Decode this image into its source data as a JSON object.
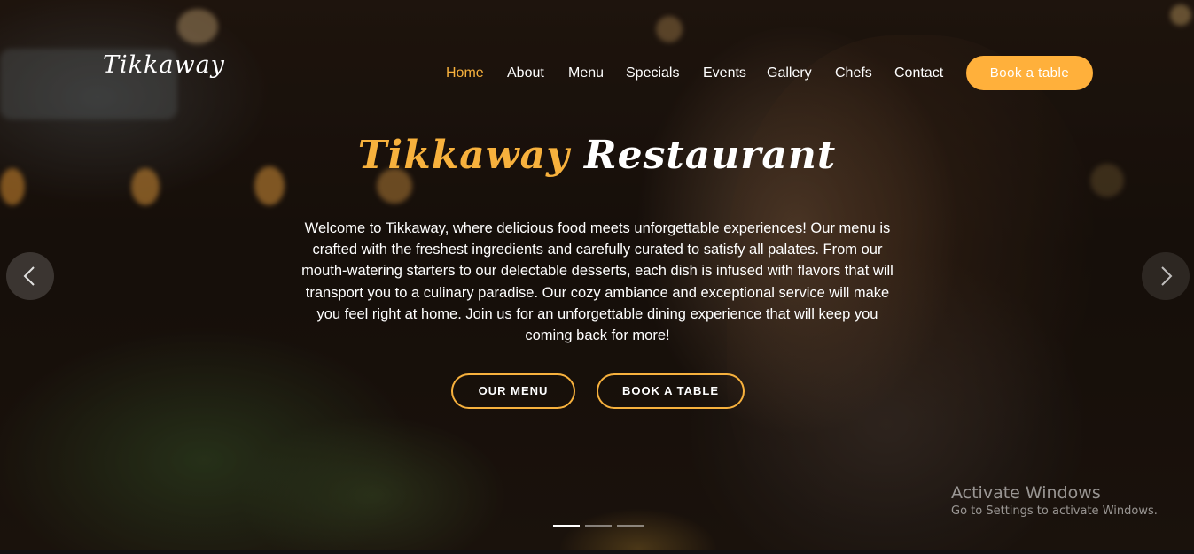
{
  "brand": {
    "logo": "Tikkaway"
  },
  "nav": {
    "items": [
      {
        "label": "Home",
        "active": true
      },
      {
        "label": "About"
      },
      {
        "label": "Menu"
      },
      {
        "label": "Specials"
      },
      {
        "label": "Events"
      },
      {
        "label": "Gallery"
      },
      {
        "label": "Chefs"
      },
      {
        "label": "Contact"
      }
    ],
    "cta": "Book a table"
  },
  "hero": {
    "title_accent": "Tikkaway",
    "title_rest": "Restaurant",
    "description": "Welcome to Tikkaway, where delicious food meets unforgettable experiences! Our menu is crafted with the freshest ingredients and carefully curated to satisfy all palates. From our mouth-watering starters to our delectable desserts, each dish is infused with flavors that will transport you to a culinary paradise. Our cozy ambiance and exceptional service will make you feel right at home. Join us for an unforgettable dining experience that will keep you coming back for more!",
    "buttons": {
      "menu": "OUR MENU",
      "table": "BOOK A TABLE"
    }
  },
  "carousel": {
    "slide_count": 3,
    "active_slide": 1
  },
  "watermark": {
    "title": "Activate Windows",
    "subtitle": "Go to Settings to activate Windows."
  },
  "colors": {
    "accent": "#ffb03b"
  },
  "icons": {
    "prev": "chevron-left-icon",
    "next": "chevron-right-icon"
  }
}
